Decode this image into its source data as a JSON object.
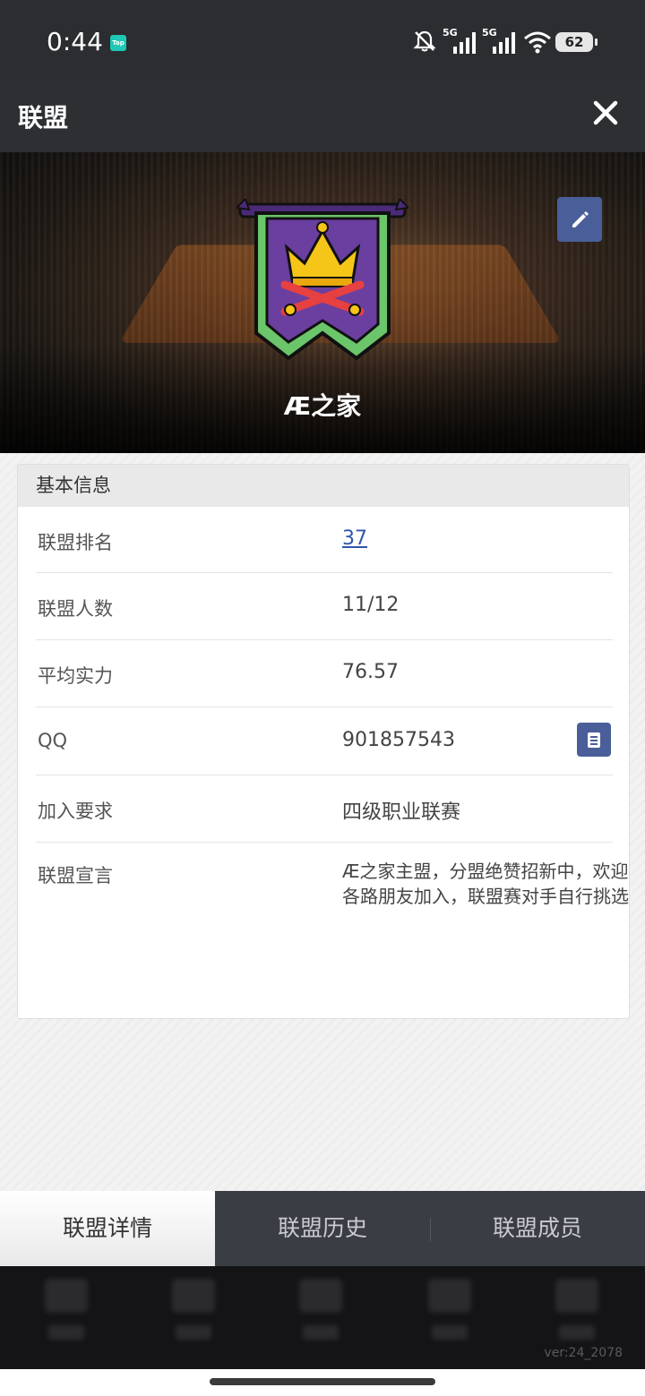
{
  "status_bar": {
    "time": "0:44",
    "app_badge": "Tap",
    "battery": "62",
    "signal_1": "5G",
    "signal_2": "5G"
  },
  "titlebar": {
    "title": "联盟"
  },
  "banner": {
    "team_name": "Æ之家"
  },
  "basic_info": {
    "header": "基本信息",
    "rows": [
      {
        "label": "联盟排名",
        "value": "37"
      },
      {
        "label": "联盟人数",
        "value": "11/12"
      },
      {
        "label": "平均实力",
        "value": "76.57"
      },
      {
        "label": "QQ",
        "value": "901857543"
      },
      {
        "label": "加入要求",
        "value": "四级职业联赛"
      },
      {
        "label": "联盟宣言",
        "value": "Æ之家主盟，分盟绝赞招新中，欢迎各路朋友加入，联盟赛对手自行挑选"
      }
    ]
  },
  "tabs": [
    {
      "label": "联盟详情",
      "active": true
    },
    {
      "label": "联盟历史",
      "active": false
    },
    {
      "label": "联盟成员",
      "active": false
    }
  ],
  "footer": {
    "version": "ver:24_2078"
  },
  "colors": {
    "accent_button": "#4a5f9a",
    "link": "#2e57a8",
    "emblem_purple": "#6a3fa0",
    "emblem_green": "#6bc56a"
  }
}
